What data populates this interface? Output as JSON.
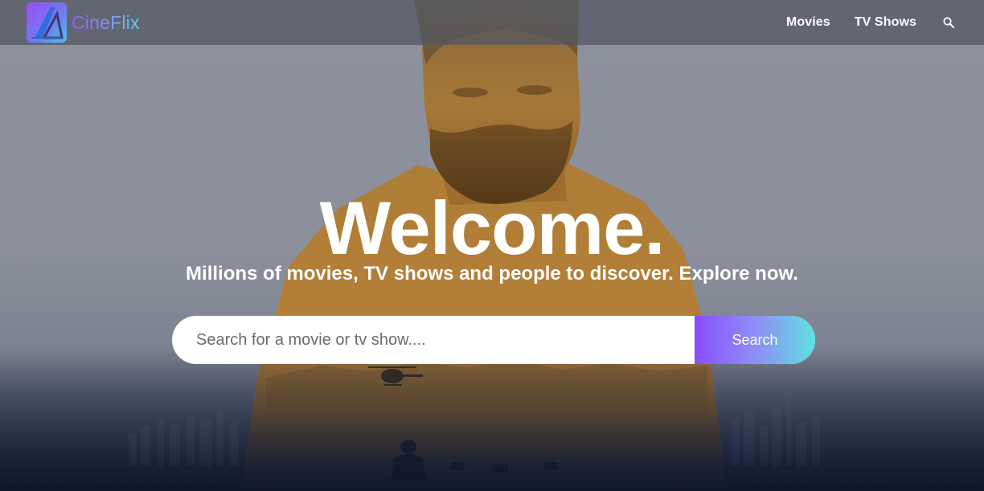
{
  "header": {
    "logo_text": "CineFlix",
    "nav": [
      {
        "label": "Movies"
      },
      {
        "label": "TV Shows"
      }
    ]
  },
  "hero": {
    "title": "Welcome.",
    "subtitle": "Millions of movies, TV shows and people to discover. Explore now.",
    "search": {
      "placeholder": "Search for a movie or tv show....",
      "value": "",
      "button_label": "Search"
    }
  },
  "icons": {
    "logo": "cineflix-logo-icon",
    "nav_search": "search-icon"
  },
  "colors": {
    "brand_gradient_start": "#8a4dff",
    "brand_gradient_end": "#5ee0e3",
    "header_bg": "#505662",
    "hero_bg": "#8a8f9b",
    "text": "#ffffff"
  }
}
